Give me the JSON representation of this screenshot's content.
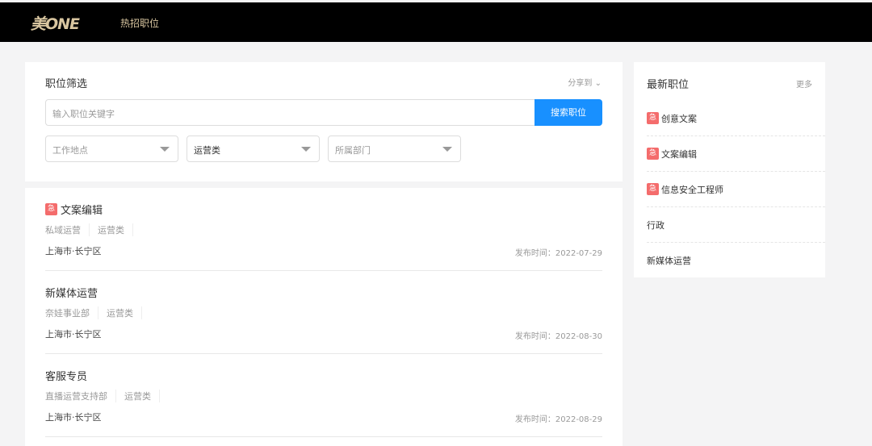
{
  "header": {
    "logo": "美ONE",
    "nav": "热招职位"
  },
  "filter": {
    "title": "职位筛选",
    "share": "分享到",
    "search_placeholder": "输入职位关键字",
    "search_button": "搜索职位",
    "location": "工作地点",
    "category": "运营类",
    "department": "所属部门"
  },
  "jobs": [
    {
      "title": "文案编辑",
      "urgent": true,
      "tags": [
        "私域运营",
        "运营类"
      ],
      "location": "上海市·长宁区",
      "date": "发布时间：2022-07-29"
    },
    {
      "title": "新媒体运营",
      "urgent": false,
      "tags": [
        "奈娃事业部",
        "运营类"
      ],
      "location": "上海市·长宁区",
      "date": "发布时间：2022-08-30"
    },
    {
      "title": "客服专员",
      "urgent": false,
      "tags": [
        "直播运营支持部",
        "运营类"
      ],
      "location": "上海市·长宁区",
      "date": "发布时间：2022-08-29"
    }
  ],
  "latest": {
    "title": "最新职位",
    "more": "更多",
    "badge": "急",
    "items": [
      "创意文案",
      "文案编辑",
      "信息安全工程师",
      "行政",
      "新媒体运营"
    ]
  }
}
